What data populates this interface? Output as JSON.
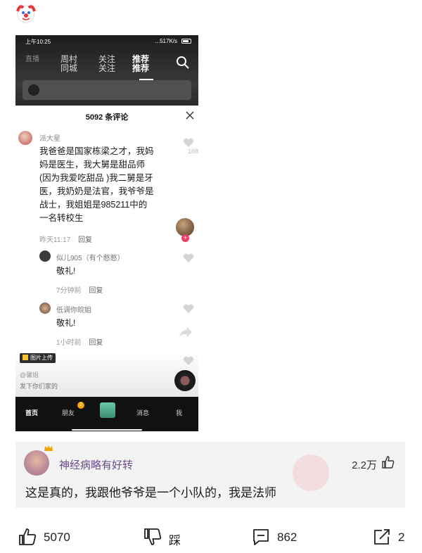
{
  "phone": {
    "status": {
      "time": "上午10:25",
      "network": "...517K/s"
    },
    "nav_tabs": [
      {
        "label": "周村",
        "ghost": "直播"
      },
      {
        "label": "同城",
        "ghost": "周村"
      },
      {
        "label": "关注",
        "ghost": "关注"
      },
      {
        "label": "推荐",
        "ghost": "推荐"
      }
    ],
    "comment_sheet": {
      "title": "5092 条评论",
      "main_comment": {
        "user": "派大星",
        "text_lines": [
          "我爸爸是国家栋梁之才，我妈",
          "妈是医生，我大舅是甜品师",
          "(因为我爱吃甜品 )我二舅是牙",
          "医，我奶奶是法官，我爷爷是",
          "战士，我姐姐是985211中的",
          "一名转校生"
        ],
        "time": "昨天11:17",
        "reply_label": "回复",
        "likes": "168"
      },
      "replies": [
        {
          "user": "似儿905（有个憨憨）",
          "text": "敬礼!",
          "time": "7分钟前",
          "reply_label": "回复"
        },
        {
          "user": "低调你皖姐",
          "text": "敬礼!",
          "time": "1小时前",
          "reply_label": "回复"
        }
      ],
      "upload_chip": "图片上传",
      "faded_user": "@馨姐",
      "faded_caption": "发下你们家的"
    },
    "bottom_tabs": {
      "home": "首页",
      "friends": "朋友",
      "friends_badge": "2",
      "messages": "消息",
      "me": "我"
    }
  },
  "reply_card": {
    "user": "神经病略有好转",
    "likes": "2.2万",
    "text": "这是真的，我跟他爷爷是一个小队的，我是法师"
  },
  "action_bar": {
    "like_count": "5070",
    "dislike_label": "踩",
    "comment_count": "862",
    "share_count": "2"
  },
  "colors": {
    "username": "#6a4a8a",
    "card_bg": "#f3f3f3",
    "badge": "#f2a500"
  }
}
